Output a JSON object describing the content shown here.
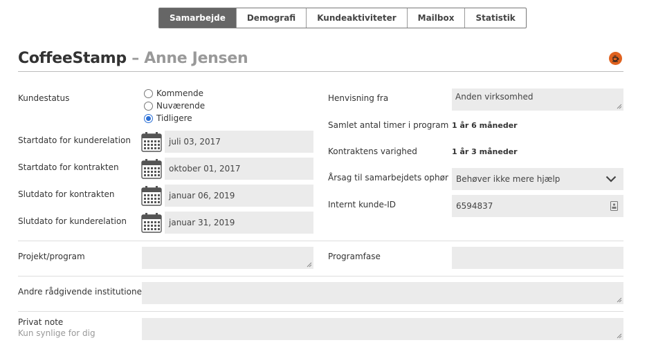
{
  "tabs": [
    {
      "label": "Samarbejde",
      "active": true
    },
    {
      "label": "Demografi",
      "active": false
    },
    {
      "label": "Kundeaktiviteter",
      "active": false
    },
    {
      "label": "Mailbox",
      "active": false
    },
    {
      "label": "Statistik",
      "active": false
    }
  ],
  "header": {
    "company": "CoffeeStamp",
    "separator": "–",
    "person": "Anne Jensen",
    "icon": "coffee-icon",
    "icon_color": "#e0621f"
  },
  "left": {
    "status_label": "Kundestatus",
    "status_options": [
      "Kommende",
      "Nuværende",
      "Tidligere"
    ],
    "status_selected": "Tidligere",
    "dates": [
      {
        "label": "Startdato for kunderelation",
        "value": "juli 03, 2017"
      },
      {
        "label": "Startdato for kontrakten",
        "value": "oktober 01, 2017"
      },
      {
        "label": "Slutdato for kontrakten",
        "value": "januar 06, 2019"
      },
      {
        "label": "Slutdato for kunderelation",
        "value": "januar 31, 2019"
      }
    ]
  },
  "right": {
    "referral_label": "Henvisning fra",
    "referral_value": "Anden virksomhed",
    "hours_label": "Samlet antal timer i program",
    "hours_value": "1 år 6 måneder",
    "duration_label": "Kontraktens varighed",
    "duration_value": "1 år 3 måneder",
    "reason_label": "Årsag til samarbejdets ophør",
    "reason_value": "Behøver ikke mere hjælp",
    "internal_id_label": "Internt kunde-ID",
    "internal_id_value": "6594837"
  },
  "lower": {
    "project_label": "Projekt/program",
    "project_value": "",
    "phase_label": "Programfase",
    "phase_value": "",
    "advisors_label": "Andre rådgivende institutioner",
    "advisors_value": "",
    "note_label": "Privat note",
    "note_sublabel": "Kun synlige for dig",
    "note_value": ""
  },
  "colors": {
    "active_tab": "#666666",
    "field_bg": "#ebebeb",
    "radio_selected": "#2a6fd6"
  }
}
